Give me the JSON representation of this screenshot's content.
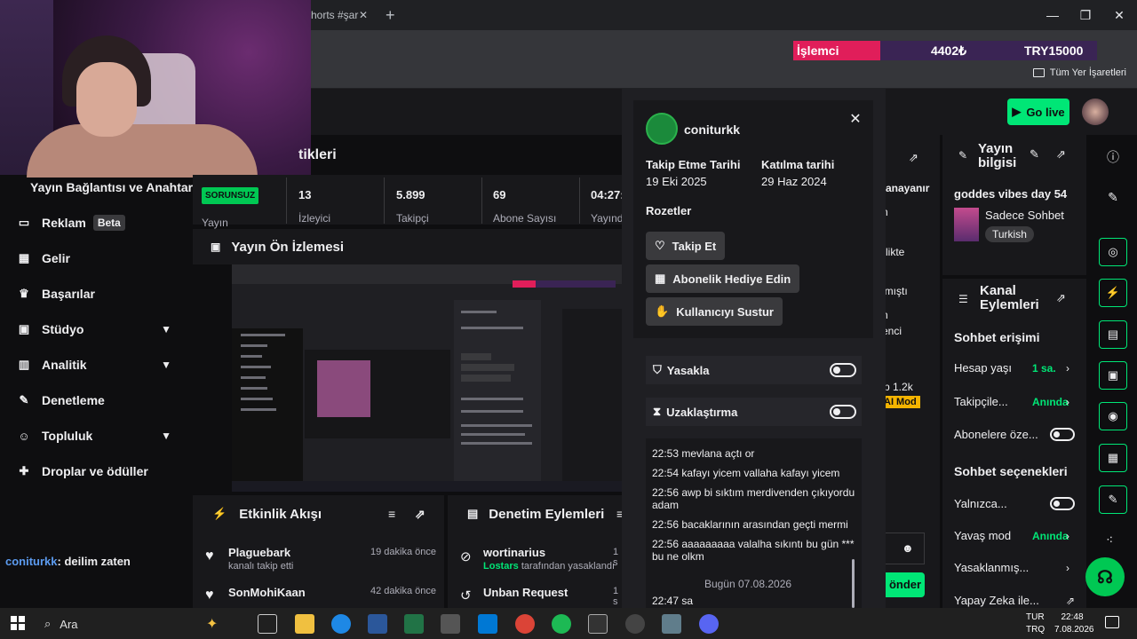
{
  "browser": {
    "tab_title": "horts #şar",
    "bookmark_folder": "Tüm Yer İşaretleri"
  },
  "overlay": {
    "label": "İşlemci",
    "amount": "4402₺",
    "goal": "TRY15000"
  },
  "sidebar": {
    "top_item": "Yayın Bağlantısı ve Anahtarı",
    "items": [
      {
        "label": "Reklam",
        "badge": "Beta",
        "icon": "ad-icon"
      },
      {
        "label": "Gelir",
        "icon": "chart-icon"
      },
      {
        "label": "Başarılar",
        "icon": "trophy-icon"
      },
      {
        "label": "Stüdyo",
        "icon": "studio-icon",
        "expandable": true
      },
      {
        "label": "Analitik",
        "icon": "analytics-icon",
        "expandable": true
      },
      {
        "label": "Denetleme",
        "icon": "wrench-icon"
      },
      {
        "label": "Topluluk",
        "icon": "community-icon",
        "expandable": true
      },
      {
        "label": "Droplar ve ödüller",
        "icon": "gift-icon"
      }
    ],
    "chat": {
      "user": "coniturkk",
      "text": ": deilim zaten"
    }
  },
  "stats": {
    "title": "tikleri",
    "status": "SORUNSUZ",
    "status_label": "Yayın",
    "items": [
      {
        "value": "13",
        "label": "İzleyici"
      },
      {
        "value": "5.899",
        "label": "Takipçi"
      },
      {
        "value": "69",
        "label": "Abone Sayısı"
      },
      {
        "value": "04:27:",
        "label": "Yayınd"
      }
    ]
  },
  "preview": {
    "title": "Yayın Ön İzlemesi"
  },
  "activity": {
    "title": "Etkinlik Akışı",
    "items": [
      {
        "name": "Plaguebark",
        "sub": "kanalı takip etti",
        "time": "19 dakika önce"
      },
      {
        "name": "SonMohiKaan",
        "sub": "",
        "time": "42 dakika önce"
      }
    ]
  },
  "moderation": {
    "title": "Denetim Eylemleri",
    "items": [
      {
        "name": "wortinarius",
        "sub_user": "Lostars",
        "sub_text": "tarafından yasaklandı",
        "time": "1 s"
      },
      {
        "name": "Unban Request",
        "time": "1 s"
      }
    ]
  },
  "user_card": {
    "name": "coniturkk",
    "follow_date_label": "Takip Etme Tarihi",
    "follow_date": "19 Eki 2025",
    "join_date_label": "Katılma tarihi",
    "join_date": "29 Haz 2024",
    "badges_label": "Rozetler",
    "buttons": [
      "Takip Et",
      "Abonelik Hediye Edin",
      "Kullanıcıyı Sustur"
    ],
    "ban_label": "Yasakla",
    "timeout_label": "Uzaklaştırma",
    "messages": [
      "22:53 mevlana açtı or",
      "22:54 kafayı yicem vallaha kafayı yicem",
      "22:56 awp bi sıktım merdivenden çıkıyordu adam",
      "22:56 bacaklarının arasından geçti mermi",
      "22:56 aaaaaaaaa valalha sıkıntı bu gün *** bu ne olkm"
    ],
    "today": "Bugün 07.08.2026",
    "last_message": "22:47 sa"
  },
  "behind_column": {
    "lines": [
      "anayanır",
      "n",
      "rlikte",
      "lmıştı",
      "n",
      "enci",
      "p 1.2k"
    ],
    "mod_badge": "AI Mod",
    "send": "önder"
  },
  "stream_info": {
    "title": "Yayın bilgisi",
    "stream_title": "goddes vibes day 54",
    "category": "Sadece Sohbet",
    "tag": "Turkish"
  },
  "channel_actions": {
    "title": "Kanal Eylemleri",
    "chat_access_title": "Sohbet erişimi",
    "chat_access": [
      {
        "label": "Hesap yaşı",
        "value": "1 sa."
      },
      {
        "label": "Takipçile...",
        "value": "Anında"
      },
      {
        "label": "Abonelere öze...",
        "toggle": true
      }
    ],
    "chat_options_title": "Sohbet seçenekleri",
    "chat_options": [
      {
        "label": "Yalnızca...",
        "toggle": true
      },
      {
        "label": "Yavaş mod",
        "value": "Anında"
      },
      {
        "label": "Yasaklanmış...",
        "value": ""
      },
      {
        "label": "Yapay Zeka ile...",
        "value": ""
      }
    ]
  },
  "header": {
    "go_live": "Go live"
  },
  "taskbar": {
    "search": "Ara",
    "lang": "TUR",
    "lang2": "TRQ",
    "time": "22:48",
    "date": "7.08.2026"
  },
  "colors": {
    "accent": "#00e676",
    "background": "#0e0e10",
    "panel": "#18181b",
    "overlay_red": "#e01e5a",
    "overlay_purple": "#3a2454"
  }
}
